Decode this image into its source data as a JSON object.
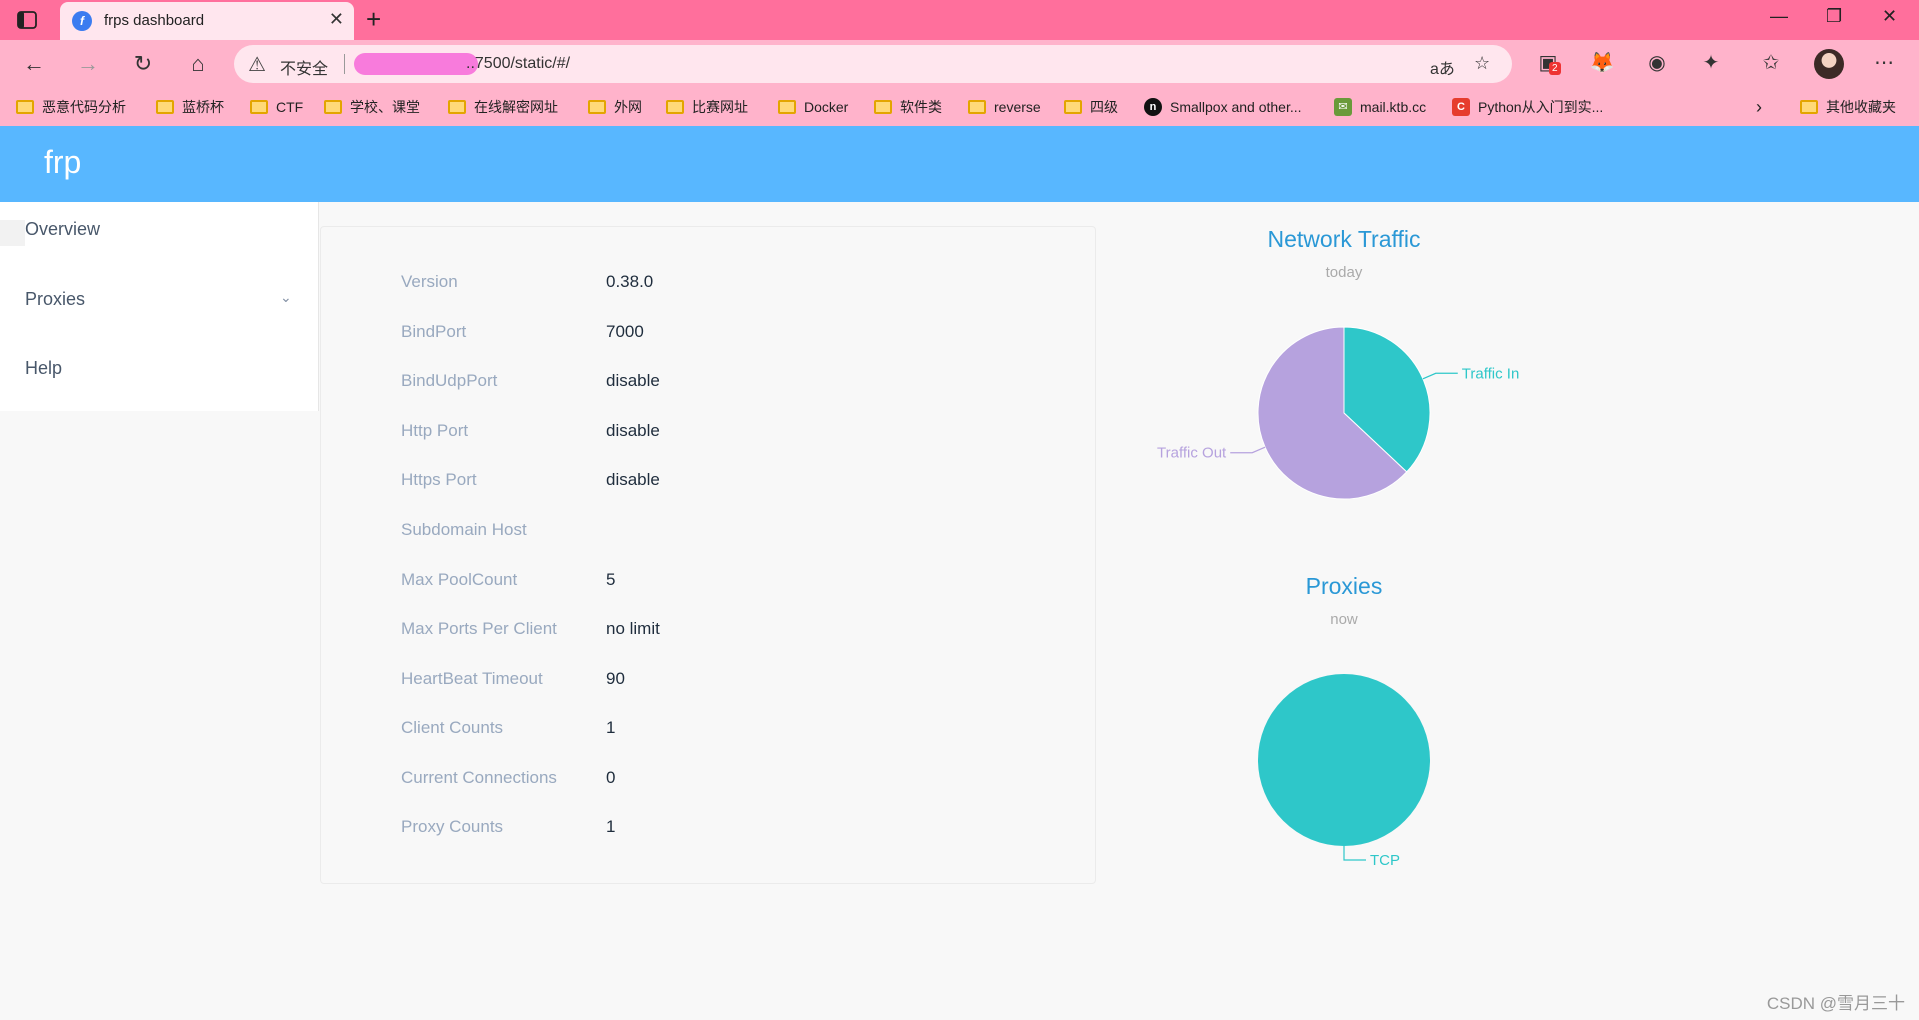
{
  "browser": {
    "tab_title": "frps dashboard",
    "insecure_label": "不安全",
    "url": "..7500/static/#/",
    "bookmarks": [
      "恶意代码分析",
      "蓝桥杯",
      "CTF",
      "学校、课堂",
      "在线解密网址",
      "外网",
      "比赛网址",
      "Docker",
      "软件类",
      "reverse",
      "四级",
      "Smallpox and other...",
      "mail.ktb.cc",
      "Python从入门到实...",
      "其他收藏夹"
    ],
    "extension_badge": "2"
  },
  "app": {
    "title": "frp",
    "menu": [
      "Overview",
      "Proxies",
      "Help"
    ]
  },
  "overview": {
    "rows": [
      {
        "label": "Version",
        "value": "0.38.0"
      },
      {
        "label": "BindPort",
        "value": "7000"
      },
      {
        "label": "BindUdpPort",
        "value": "disable"
      },
      {
        "label": "Http Port",
        "value": "disable"
      },
      {
        "label": "Https Port",
        "value": "disable"
      },
      {
        "label": "Subdomain Host",
        "value": ""
      },
      {
        "label": "Max PoolCount",
        "value": "5"
      },
      {
        "label": "Max Ports Per Client",
        "value": "no limit"
      },
      {
        "label": "HeartBeat Timeout",
        "value": "90"
      },
      {
        "label": "Client Counts",
        "value": "1"
      },
      {
        "label": "Current Connections",
        "value": "0"
      },
      {
        "label": "Proxy Counts",
        "value": "1"
      }
    ]
  },
  "chart_data": [
    {
      "type": "pie",
      "title": "Network Traffic",
      "subtitle": "today",
      "series": [
        {
          "name": "Traffic In",
          "value": 37,
          "color": "#2ec7c9"
        },
        {
          "name": "Traffic Out",
          "value": 63,
          "color": "#b6a2de"
        }
      ]
    },
    {
      "type": "pie",
      "title": "Proxies",
      "subtitle": "now",
      "series": [
        {
          "name": "TCP",
          "value": 1,
          "color": "#2ec7c9"
        }
      ]
    }
  ],
  "watermark": "CSDN @雪月三十"
}
